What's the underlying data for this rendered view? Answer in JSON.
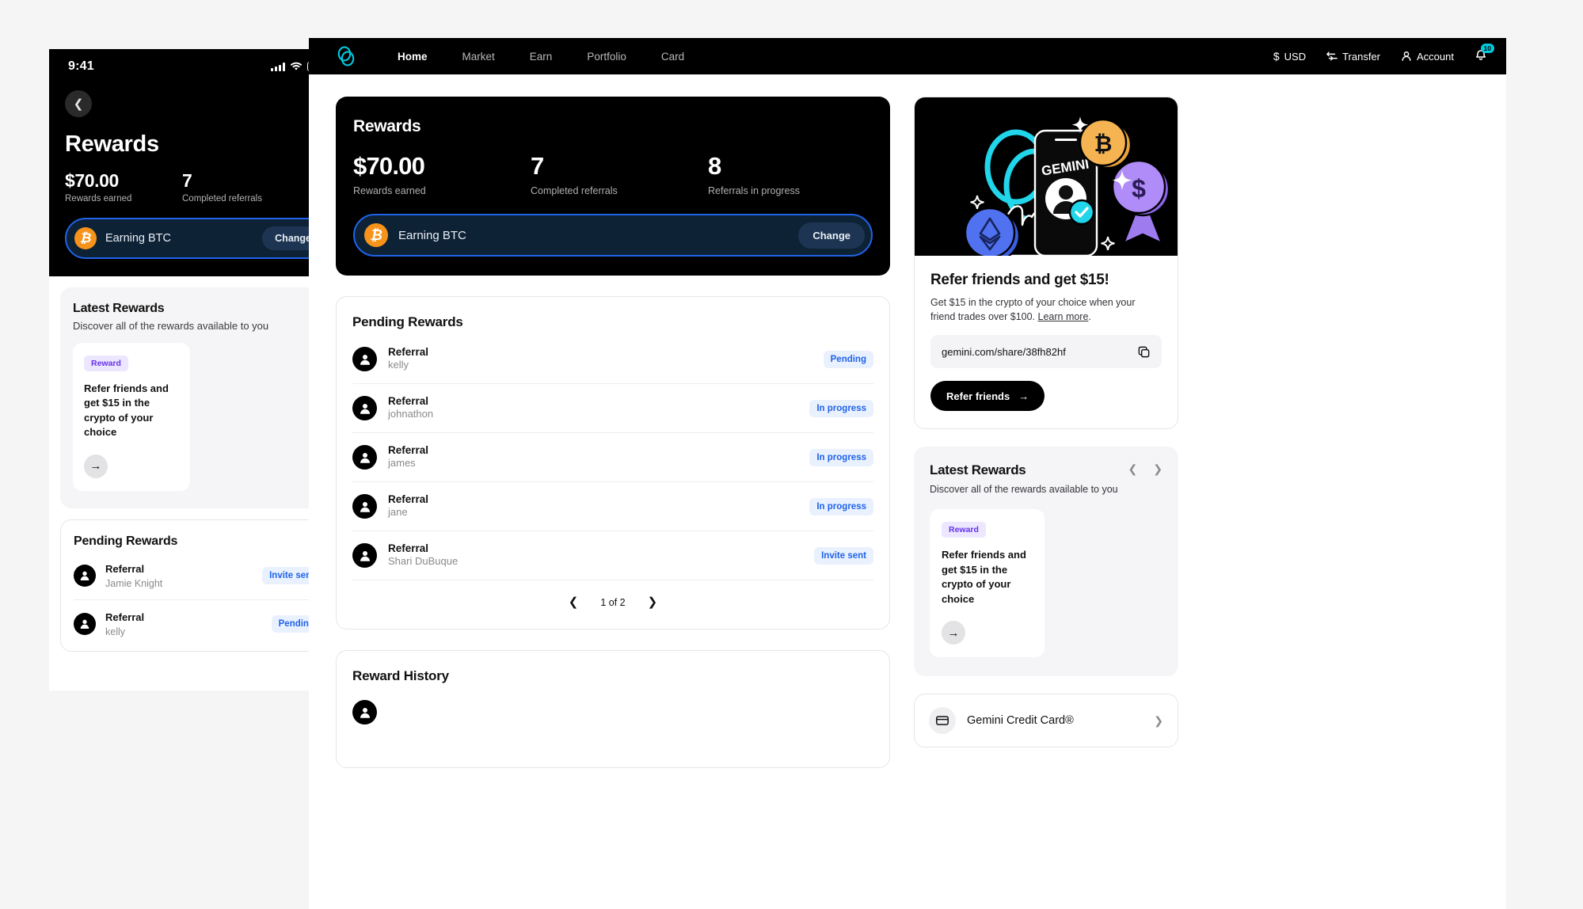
{
  "mobile": {
    "status": {
      "time": "9:41",
      "signal_icon": "signal-bars-icon",
      "wifi_icon": "wifi-icon",
      "battery_icon": "battery-icon"
    },
    "back_icon": "chevron-left-icon",
    "title": "Rewards",
    "stats": [
      {
        "value": "$70.00",
        "label": "Rewards earned"
      },
      {
        "value": "7",
        "label": "Completed referrals"
      }
    ],
    "earning_pill": {
      "coin_icon": "bitcoin-icon",
      "label": "Earning BTC",
      "button": "Change"
    },
    "latest_rewards": {
      "title": "Latest Rewards",
      "subtitle": "Discover all of the rewards available to you",
      "tile": {
        "chip": "Reward",
        "text": "Refer friends and get $15 in the crypto of your choice",
        "arrow_icon": "arrow-right-icon"
      }
    },
    "pending_rewards": {
      "title": "Pending Rewards",
      "rows": [
        {
          "title": "Referral",
          "name": "Jamie Knight",
          "status": "Invite sent"
        },
        {
          "title": "Referral",
          "name": "kelly",
          "status": "Pending"
        }
      ]
    }
  },
  "desktop": {
    "nav": {
      "logo_icon": "gemini-logo-icon",
      "links": [
        {
          "label": "Home",
          "active": true
        },
        {
          "label": "Market",
          "active": false
        },
        {
          "label": "Earn",
          "active": false
        },
        {
          "label": "Portfolio",
          "active": false
        },
        {
          "label": "Card",
          "active": false
        }
      ],
      "currency": {
        "icon": "dollar-icon",
        "label": "USD"
      },
      "transfer": {
        "icon": "transfer-icon",
        "label": "Transfer"
      },
      "account": {
        "icon": "person-icon",
        "label": "Account"
      },
      "notifications": {
        "icon": "bell-icon",
        "count": "10",
        "badge_color": "#00cbdf"
      }
    },
    "hero": {
      "title": "Rewards",
      "stats": [
        {
          "value": "$70.00",
          "label": "Rewards earned"
        },
        {
          "value": "7",
          "label": "Completed referrals"
        },
        {
          "value": "8",
          "label": "Referrals in progress"
        }
      ],
      "earning_pill": {
        "coin_icon": "bitcoin-icon",
        "label": "Earning BTC",
        "button": "Change"
      }
    },
    "pending_rewards": {
      "title": "Pending Rewards",
      "rows": [
        {
          "title": "Referral",
          "name": "kelly",
          "status": "Pending"
        },
        {
          "title": "Referral",
          "name": "johnathon",
          "status": "In progress"
        },
        {
          "title": "Referral",
          "name": "james",
          "status": "In progress"
        },
        {
          "title": "Referral",
          "name": "jane",
          "status": "In progress"
        },
        {
          "title": "Referral",
          "name": "Shari DuBuque",
          "status": "Invite sent"
        }
      ],
      "pager": {
        "prev_icon": "chevron-left-icon",
        "text": "1 of 2",
        "next_icon": "chevron-right-icon"
      }
    },
    "reward_history": {
      "title": "Reward History"
    },
    "sidebar": {
      "refer_card": {
        "illustration": "referral-illustration",
        "title": "Refer friends and get $15!",
        "body_before": "Get $15 in the crypto of your choice when your friend trades over $100. ",
        "body_link": "Learn more",
        "body_after": ".",
        "link_value": "gemini.com/share/38fh82hf",
        "copy_icon": "copy-icon",
        "button": "Refer friends",
        "button_icon": "arrow-right-icon"
      },
      "latest_rewards": {
        "title": "Latest Rewards",
        "subtitle": "Discover all of the rewards available to you",
        "prev_icon": "chevron-left-icon",
        "next_icon": "chevron-right-icon",
        "tile": {
          "chip": "Reward",
          "text": "Refer friends and get $15 in the crypto of your choice",
          "arrow_icon": "arrow-right-icon"
        }
      },
      "credit_card": {
        "icon": "credit-card-icon",
        "label": "Gemini Credit Card®",
        "chevron_icon": "chevron-right-icon"
      }
    }
  },
  "colors": {
    "accent_blue": "#1f63e8",
    "cyan": "#00cbdf",
    "bitcoin_orange": "#f7931a",
    "purple": "#6633ee"
  }
}
